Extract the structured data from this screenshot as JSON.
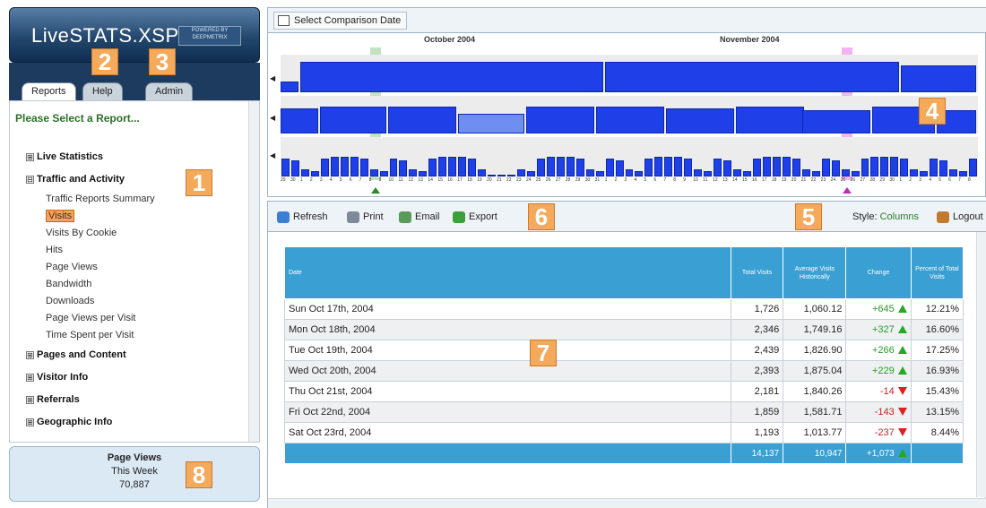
{
  "app": {
    "logo_text": "LiveSTATS.XSP",
    "logo_sub": "POWERED BY DEEPMETRIX"
  },
  "tabs": [
    {
      "label": "Reports",
      "active": true
    },
    {
      "label": "Help",
      "active": false
    },
    {
      "label": "Admin",
      "active": false
    }
  ],
  "callouts": [
    "1",
    "2",
    "3",
    "4",
    "5",
    "6",
    "7",
    "8"
  ],
  "sidebar": {
    "prompt": "Please Select a Report...",
    "categories": [
      {
        "label": "Live Statistics",
        "expanded": false,
        "items": []
      },
      {
        "label": "Traffic and Activity",
        "expanded": true,
        "items": [
          "Traffic Reports Summary",
          "Visits",
          "Visits By Cookie",
          "Hits",
          "Page Views",
          "Bandwidth",
          "Downloads",
          "Page Views per Visit",
          "Time Spent per Visit"
        ],
        "selected": "Visits"
      },
      {
        "label": "Pages and Content",
        "expanded": false,
        "items": []
      },
      {
        "label": "Visitor Info",
        "expanded": false,
        "items": []
      },
      {
        "label": "Referrals",
        "expanded": false,
        "items": []
      },
      {
        "label": "Geographic Info",
        "expanded": false,
        "items": []
      }
    ],
    "expand_symbol": "⊞",
    "collapse_symbol": "⊟"
  },
  "summary_box": {
    "title": "Page Views",
    "period": "This Week",
    "value": "70,887"
  },
  "calendar": {
    "button_label": "Select Comparison Date",
    "months": [
      "October 2004",
      "November 2004"
    ],
    "day_labels": [
      "29",
      "30",
      "1",
      "2",
      "3",
      "4",
      "5",
      "6",
      "7",
      "8",
      "9",
      "10",
      "11",
      "12",
      "13",
      "14",
      "15",
      "16",
      "17",
      "18",
      "19",
      "20",
      "21",
      "22",
      "23",
      "24",
      "25",
      "26",
      "27",
      "28",
      "29",
      "30",
      "31",
      "1",
      "2",
      "3",
      "4",
      "5",
      "6",
      "7",
      "8",
      "9",
      "10",
      "11",
      "12",
      "13",
      "14",
      "15",
      "16",
      "17",
      "18",
      "19",
      "20",
      "21",
      "22",
      "23",
      "24",
      "25",
      "26",
      "27",
      "28",
      "29",
      "30",
      "1",
      "2",
      "3",
      "4",
      "5",
      "6",
      "7",
      "8"
    ],
    "highlight_start_day": "8",
    "highlight_compare_day": "25"
  },
  "toolbar": {
    "refresh": "Refresh",
    "print": "Print",
    "email": "Email",
    "export": "Export",
    "style_label": "Style:",
    "style_value": "Columns",
    "logout": "Logout"
  },
  "table": {
    "headers": [
      "Date",
      "Total Visits",
      "Average Visits Historically",
      "Change",
      "Percent of Total Visits"
    ],
    "rows": [
      {
        "date": "Sun Oct 17th, 2004",
        "total": "1,726",
        "avg": "1,060.12",
        "change": "+645",
        "dir": "up",
        "pct": "12.21%"
      },
      {
        "date": "Mon Oct 18th, 2004",
        "total": "2,346",
        "avg": "1,749.16",
        "change": "+327",
        "dir": "up",
        "pct": "16.60%"
      },
      {
        "date": "Tue Oct 19th, 2004",
        "total": "2,439",
        "avg": "1,826.90",
        "change": "+266",
        "dir": "up",
        "pct": "17.25%"
      },
      {
        "date": "Wed Oct 20th, 2004",
        "total": "2,393",
        "avg": "1,875.04",
        "change": "+229",
        "dir": "up",
        "pct": "16.93%"
      },
      {
        "date": "Thu Oct 21st, 2004",
        "total": "2,181",
        "avg": "1,840.26",
        "change": "-14",
        "dir": "down",
        "pct": "15.43%"
      },
      {
        "date": "Fri Oct 22nd, 2004",
        "total": "1,859",
        "avg": "1,581.71",
        "change": "-143",
        "dir": "down",
        "pct": "13.15%"
      },
      {
        "date": "Sat Oct 23rd, 2004",
        "total": "1,193",
        "avg": "1,013.77",
        "change": "-237",
        "dir": "down",
        "pct": "8.44%"
      }
    ],
    "totals": {
      "total": "14,137",
      "avg": "10,947",
      "change": "+1,073",
      "dir": "up"
    }
  },
  "colors": {
    "header_blue": "#3a9fd3",
    "positive": "#2a9a2a",
    "negative": "#d02020",
    "callout": "#f5a95b",
    "bar_blue": "#1f3fe8"
  }
}
